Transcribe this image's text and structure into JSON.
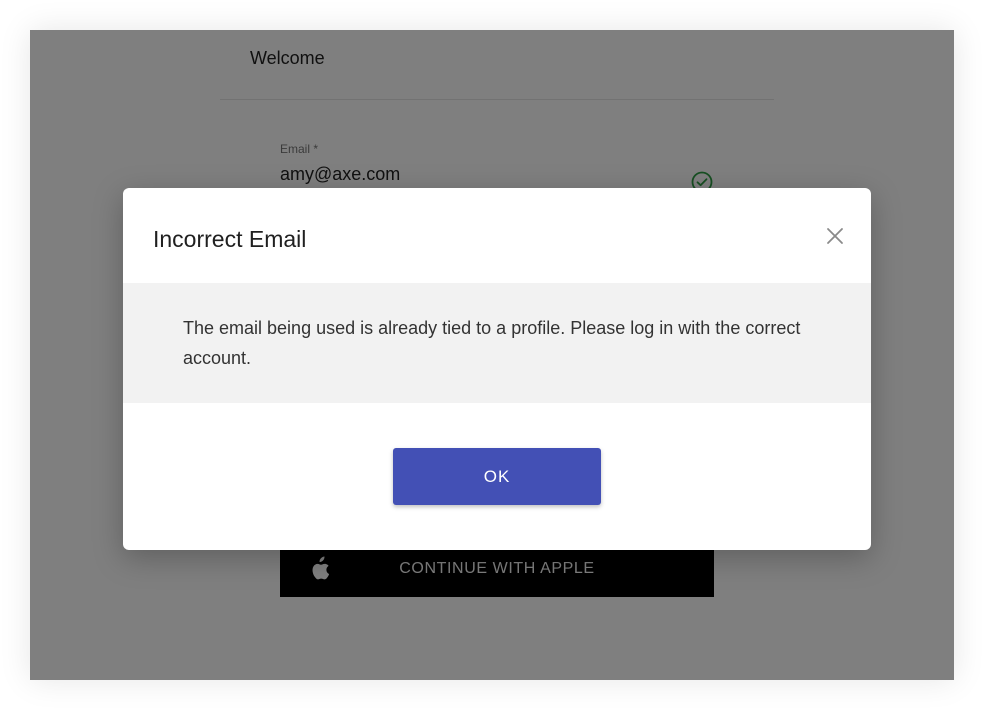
{
  "card": {
    "title": "Welcome",
    "email": {
      "label": "Email *",
      "value": "amy@axe.com",
      "status_icon": "check-circle-icon"
    },
    "apple_button": {
      "icon": "apple-icon",
      "label": "CONTINUE WITH APPLE"
    }
  },
  "modal": {
    "title": "Incorrect Email",
    "close_icon": "close-icon",
    "message": "The email being used is already tied to a profile. Please log in with the correct account.",
    "ok_label": "OK"
  },
  "colors": {
    "primary": "#4350b5",
    "success": "#2e9e44",
    "overlay": "#7f7f7f",
    "modal_body_bg": "#f2f2f2"
  }
}
